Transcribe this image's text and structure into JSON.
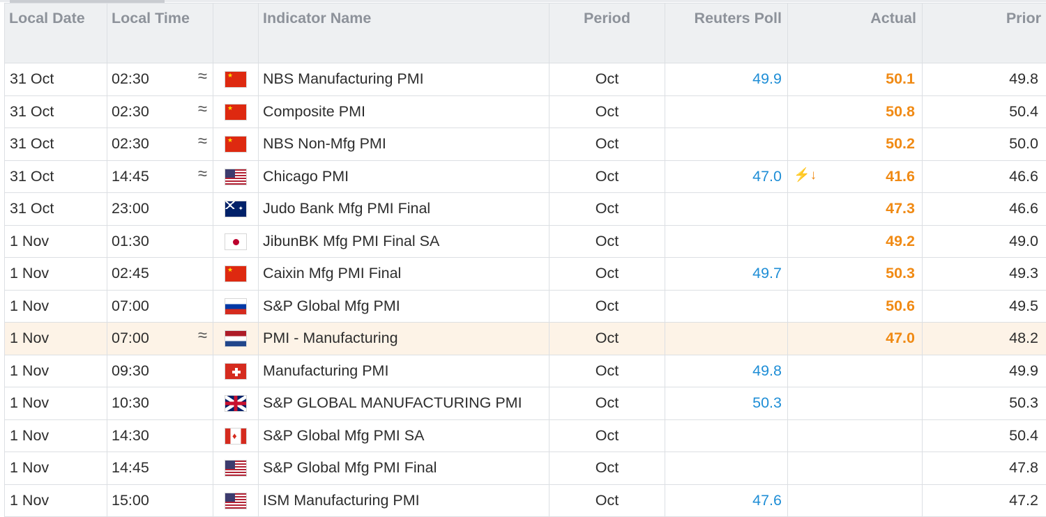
{
  "headers": {
    "local_date": "Local Date",
    "local_time": "Local Time",
    "icon": "",
    "indicator_name": "Indicator Name",
    "period": "Period",
    "reuters_poll": "Reuters Poll",
    "actual": "Actual",
    "prior": "Prior"
  },
  "colors": {
    "poll": "#1f8ed6",
    "actual": "#f08a14",
    "highlight_row": "#fdf3e7"
  },
  "rows": [
    {
      "date": "31 Oct",
      "time": "02:30",
      "trend_icon": "≈",
      "flag": "cn",
      "flag_icon": "china-flag-icon",
      "name": "NBS Manufacturing PMI",
      "period": "Oct",
      "poll": "49.9",
      "actual": "50.1",
      "surprise": "",
      "prior": "49.8"
    },
    {
      "date": "31 Oct",
      "time": "02:30",
      "trend_icon": "≈",
      "flag": "cn",
      "flag_icon": "china-flag-icon",
      "name": "Composite PMI",
      "period": "Oct",
      "poll": "",
      "actual": "50.8",
      "surprise": "",
      "prior": "50.4"
    },
    {
      "date": "31 Oct",
      "time": "02:30",
      "trend_icon": "≈",
      "flag": "cn",
      "flag_icon": "china-flag-icon",
      "name": "NBS Non-Mfg PMI",
      "period": "Oct",
      "poll": "",
      "actual": "50.2",
      "surprise": "",
      "prior": "50.0"
    },
    {
      "date": "31 Oct",
      "time": "14:45",
      "trend_icon": "≈",
      "flag": "us",
      "flag_icon": "usa-flag-icon",
      "name": "Chicago PMI",
      "period": "Oct",
      "poll": "47.0",
      "actual": "41.6",
      "surprise": "⚡↓",
      "prior": "46.6"
    },
    {
      "date": "31 Oct",
      "time": "23:00",
      "trend_icon": "",
      "flag": "au",
      "flag_icon": "australia-flag-icon",
      "name": "Judo Bank Mfg PMI Final",
      "period": "Oct",
      "poll": "",
      "actual": "47.3",
      "surprise": "",
      "prior": "46.6"
    },
    {
      "date": "1 Nov",
      "time": "01:30",
      "trend_icon": "",
      "flag": "jp",
      "flag_icon": "japan-flag-icon",
      "name": "JibunBK Mfg PMI Final SA",
      "period": "Oct",
      "poll": "",
      "actual": "49.2",
      "surprise": "",
      "prior": "49.0"
    },
    {
      "date": "1 Nov",
      "time": "02:45",
      "trend_icon": "",
      "flag": "cn",
      "flag_icon": "china-flag-icon",
      "name": "Caixin Mfg PMI Final",
      "period": "Oct",
      "poll": "49.7",
      "actual": "50.3",
      "surprise": "",
      "prior": "49.3"
    },
    {
      "date": "1 Nov",
      "time": "07:00",
      "trend_icon": "",
      "flag": "ru",
      "flag_icon": "russia-flag-icon",
      "name": "S&P Global Mfg PMI",
      "period": "Oct",
      "poll": "",
      "actual": "50.6",
      "surprise": "",
      "prior": "49.5"
    },
    {
      "date": "1 Nov",
      "time": "07:00",
      "trend_icon": "≈",
      "flag": "nl",
      "flag_icon": "netherlands-flag-icon",
      "name": "PMI - Manufacturing",
      "period": "Oct",
      "poll": "",
      "actual": "47.0",
      "surprise": "",
      "prior": "48.2",
      "highlight": true
    },
    {
      "date": "1 Nov",
      "time": "09:30",
      "trend_icon": "",
      "flag": "ch",
      "flag_icon": "switzerland-flag-icon",
      "name": "Manufacturing PMI",
      "period": "Oct",
      "poll": "49.8",
      "actual": "",
      "surprise": "",
      "prior": "49.9"
    },
    {
      "date": "1 Nov",
      "time": "10:30",
      "trend_icon": "",
      "flag": "gb",
      "flag_icon": "uk-flag-icon",
      "name": "S&P GLOBAL MANUFACTURING PMI",
      "period": "Oct",
      "poll": "50.3",
      "actual": "",
      "surprise": "",
      "prior": "50.3"
    },
    {
      "date": "1 Nov",
      "time": "14:30",
      "trend_icon": "",
      "flag": "ca",
      "flag_icon": "canada-flag-icon",
      "name": "S&P Global Mfg PMI SA",
      "period": "Oct",
      "poll": "",
      "actual": "",
      "surprise": "",
      "prior": "50.4"
    },
    {
      "date": "1 Nov",
      "time": "14:45",
      "trend_icon": "",
      "flag": "us",
      "flag_icon": "usa-flag-icon",
      "name": "S&P Global Mfg PMI Final",
      "period": "Oct",
      "poll": "",
      "actual": "",
      "surprise": "",
      "prior": "47.8"
    },
    {
      "date": "1 Nov",
      "time": "15:00",
      "trend_icon": "",
      "flag": "us",
      "flag_icon": "usa-flag-icon",
      "name": "ISM Manufacturing PMI",
      "period": "Oct",
      "poll": "47.6",
      "actual": "",
      "surprise": "",
      "prior": "47.2"
    }
  ]
}
